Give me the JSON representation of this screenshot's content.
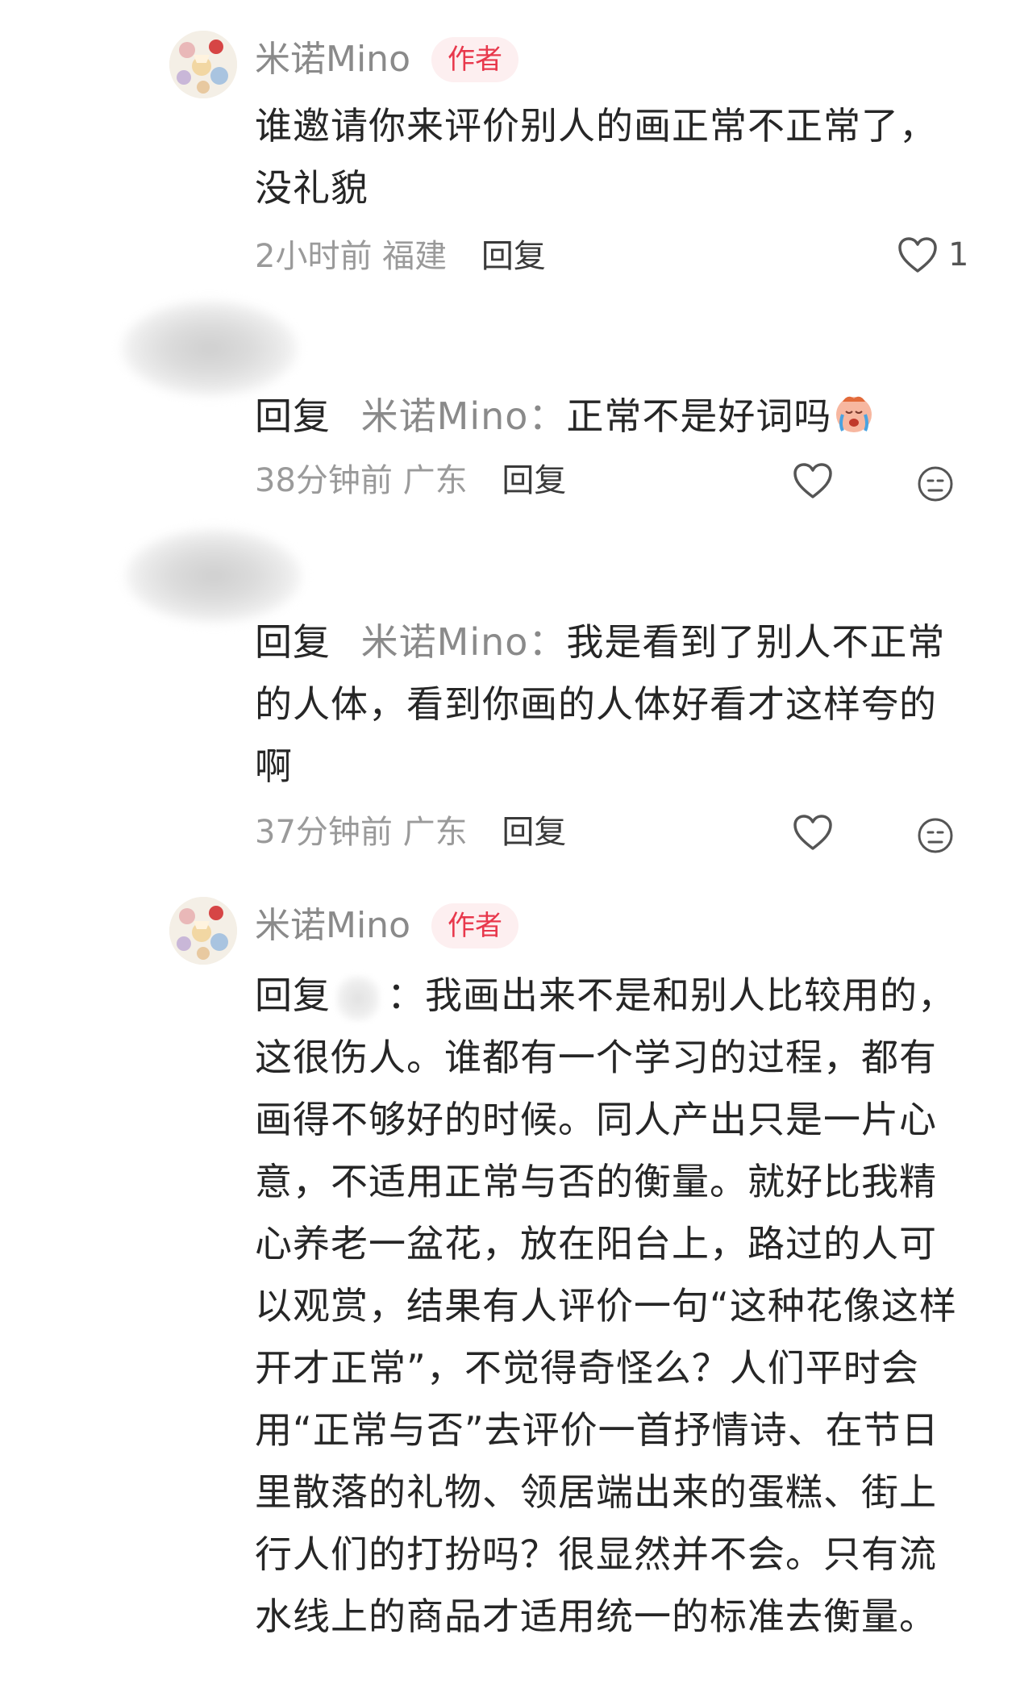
{
  "comments": [
    {
      "username": "米诺Mino",
      "badge": "作者",
      "text": "谁邀请你来评价别人的画正常不正常了，没礼貌",
      "time": "2小时前",
      "location": "福建",
      "reply_label": "回复",
      "likes": "1"
    },
    {
      "reply_prefix": "回复",
      "mention": "米诺Mino：",
      "text": "正常不是好词吗",
      "time": "38分钟前",
      "location": "广东",
      "reply_label": "回复"
    },
    {
      "reply_prefix": "回复",
      "mention": "米诺Mino：",
      "text": "我是看到了别人不正常的人体，看到你画的人体好看才这样夸的啊",
      "time": "37分钟前",
      "location": "广东",
      "reply_label": "回复"
    },
    {
      "username": "米诺Mino",
      "badge": "作者",
      "reply_prefix": "回复",
      "mention": "：",
      "text": "我画出来不是和别人比较用的，这很伤人。谁都有一个学习的过程，都有画得不够好的时候。同人产出只是一片心意，不适用正常与否的衡量。就好比我精心养老一盆花，放在阳台上，路过的人可以观赏，结果有人评价一句“这种花像这样开才正常”，不觉得奇怪么？人们平时会用“正常与否”去评价一首抒情诗、在节日里散落的礼物、领居端出来的蛋糕、街上行人们的打扮吗？很显然并不会。只有流水线上的商品才适用统一的标准去衡量。"
    }
  ],
  "colors": {
    "badge_text": "#e8384c",
    "badge_bg": "#fdeff0",
    "meta": "#9a9a9a",
    "username": "#8a8a8a"
  },
  "icons": [
    "heart-icon",
    "dislike-face-icon",
    "crying-emoji"
  ]
}
